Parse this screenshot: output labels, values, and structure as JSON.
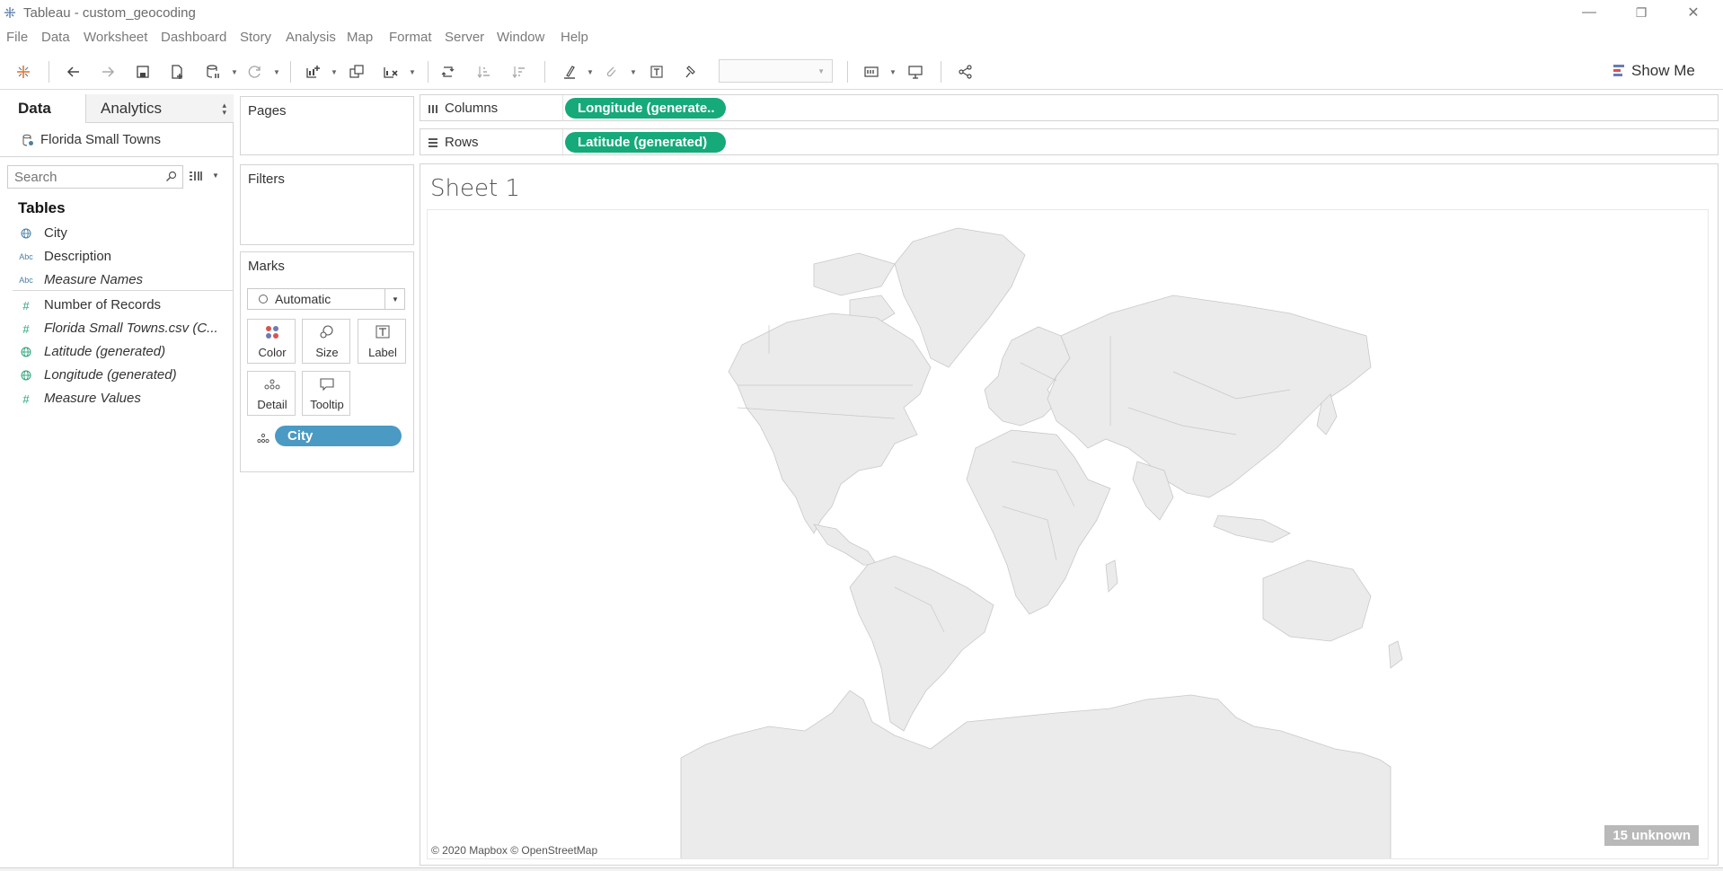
{
  "window": {
    "title": "Tableau - custom_geocoding",
    "minimize": "—",
    "restore": "❐",
    "close": "✕"
  },
  "menu": [
    "File",
    "Data",
    "Worksheet",
    "Dashboard",
    "Story",
    "Analysis",
    "Map",
    "Format",
    "Server",
    "Window",
    "Help"
  ],
  "toolbar": {
    "show_me_label": "Show Me"
  },
  "data_pane": {
    "tabs": {
      "data": "Data",
      "analytics": "Analytics"
    },
    "datasource": "Florida Small Towns",
    "search_placeholder": "Search",
    "tables_heading": "Tables",
    "dimensions": [
      {
        "name": "City",
        "icon": "globe-icon"
      },
      {
        "name": "Description",
        "icon": "abc-icon"
      },
      {
        "name": "Measure Names",
        "icon": "abc-icon"
      }
    ],
    "measures": [
      {
        "name": "Number of Records",
        "icon": "measure-icon"
      },
      {
        "name": "Florida Small Towns.csv (C...",
        "icon": "measure-icon"
      },
      {
        "name": "Latitude (generated)",
        "icon": "globe-icon"
      },
      {
        "name": "Longitude (generated)",
        "icon": "globe-icon"
      },
      {
        "name": "Measure Values",
        "icon": "measure-icon"
      }
    ]
  },
  "cards": {
    "pages": "Pages",
    "filters": "Filters",
    "marks": "Marks",
    "mark_type": "Automatic",
    "mark_buttons": {
      "color": "Color",
      "size": "Size",
      "label": "Label",
      "detail": "Detail",
      "tooltip": "Tooltip"
    },
    "marks_pill": "City",
    "abc": "Abc"
  },
  "shelves": {
    "columns_label": "Columns",
    "columns_pill": "Longitude (generate..",
    "rows_label": "Rows",
    "rows_pill": "Latitude (generated)"
  },
  "view": {
    "sheet_title": "Sheet 1",
    "attribution": "© 2020 Mapbox © OpenStreetMap",
    "unknown_badge": "15 unknown"
  },
  "colors": {
    "pill_green": "#16a97a",
    "pill_blue": "#4b9ac4",
    "land": "#ebebeb",
    "border": "#c8c8c8"
  }
}
